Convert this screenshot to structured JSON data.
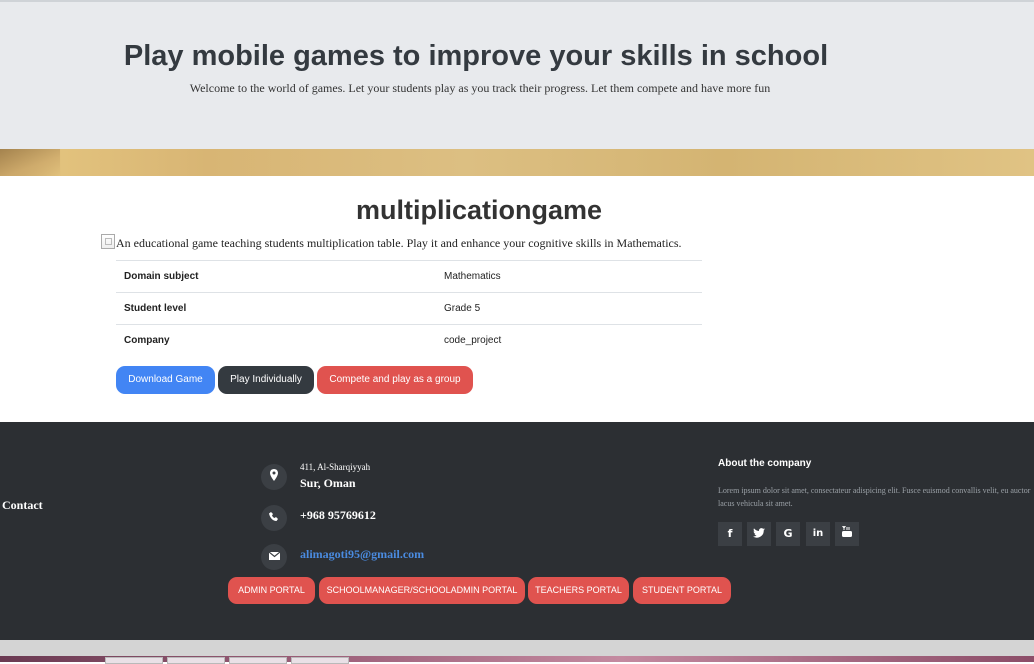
{
  "hero": {
    "title": "Play mobile games to improve your skills in school",
    "subtitle": "Welcome to the world of games. Let your students play as you track their progress. Let them compete and have more fun"
  },
  "game": {
    "title": "multiplicationgame",
    "description": "An educational game teaching students multiplication table. Play it and enhance your cognitive skills in Mathematics.",
    "details": [
      {
        "label": "Domain subject",
        "value": "Mathematics"
      },
      {
        "label": "Student level",
        "value": "Grade 5"
      },
      {
        "label": "Company",
        "value": "code_project"
      }
    ],
    "buttons": {
      "download": "Download Game",
      "play": "Play Individually",
      "compete": "Compete and play as a group"
    }
  },
  "footer": {
    "contact_heading": "Contact",
    "address_line1": "411, Al-Sharqiyyah",
    "address_line2": "Sur, Oman",
    "phone": "+968 95769612",
    "email": "alimagoti95@gmail.com",
    "about_heading": "About the company",
    "about_text": "Lorem ipsum dolor sit amet, consectateur adispicing elit. Fusce euismod convallis velit, eu auctor lacus vehicula sit amet.",
    "social_icons": [
      "facebook-icon",
      "twitter-icon",
      "google-icon",
      "linkedin-icon",
      "youtube-icon"
    ],
    "portals": {
      "admin": "ADMIN PORTAL",
      "schoolmanager": "SCHOOLMANAGER/SCHOOLADMIN PORTAL",
      "teachers": "TEACHERS PORTAL",
      "student": "STUDENT PORTAL"
    }
  },
  "colors": {
    "primary": "#4285f4",
    "dark": "#343a40",
    "danger": "#e0534f",
    "footer_bg": "#2c2f33"
  }
}
